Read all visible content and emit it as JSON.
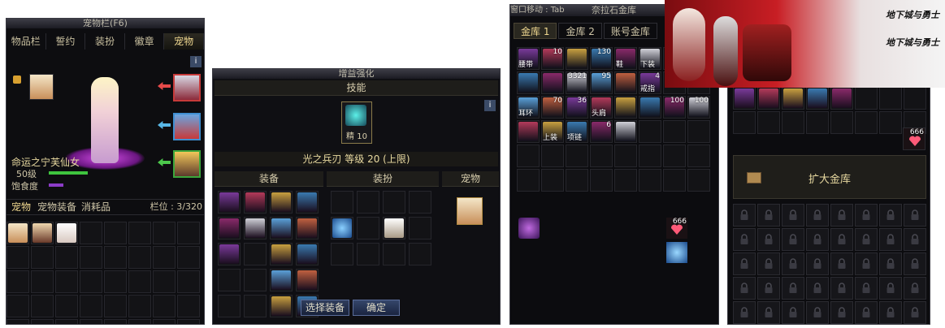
{
  "pet_panel": {
    "title": "宠物栏(F6)",
    "tabs": [
      "物品栏",
      "誓约",
      "装扮",
      "徽章",
      "宠物"
    ],
    "active_tab": "宠物",
    "info_icon": "i",
    "pet_name": "命运之宁芙仙女",
    "level": "50级",
    "satiety_label": "饱食度",
    "bottom_tabs": [
      "宠物",
      "宠物装备",
      "消耗品"
    ],
    "slots_label": "栏位 : 3/320"
  },
  "enhance_panel": {
    "title": "增益强化",
    "skill_header": "技能",
    "skill_icon_caption": "精 10",
    "skill_line": "光之兵刃 等级 20 (上限)",
    "col_equip": "装备",
    "col_avatar": "装扮",
    "col_pet": "宠物",
    "select_button": "选择装备",
    "confirm_button": "确定"
  },
  "storage_panel": {
    "title": "奈拉石金库",
    "window_move_hint": "窗口移动 : Tab",
    "tabs": [
      "金库 1",
      "金库 2",
      "账号金库"
    ],
    "items_row1": [
      {
        "label": "腰带",
        "qty": ""
      },
      {
        "label": "",
        "qty": "10"
      },
      {
        "label": "",
        "qty": ""
      },
      {
        "label": "",
        "qty": "130"
      },
      {
        "label": "鞋",
        "qty": ""
      },
      {
        "label": "下装",
        "qty": ""
      }
    ],
    "items_row2": [
      {
        "label": "",
        "qty": ""
      },
      {
        "label": "",
        "qty": ""
      },
      {
        "label": "",
        "qty": "3321"
      },
      {
        "label": "",
        "qty": "95"
      },
      {
        "label": "",
        "qty": ""
      },
      {
        "label": "戒指",
        "qty": "4"
      }
    ],
    "items_row3": [
      {
        "label": "耳环",
        "qty": ""
      },
      {
        "label": "",
        "qty": "70"
      },
      {
        "label": "",
        "qty": "36"
      },
      {
        "label": "头肩",
        "qty": ""
      },
      {
        "label": "",
        "qty": ""
      },
      {
        "label": "",
        "qty": ""
      },
      {
        "label": "",
        "qty": "100"
      },
      {
        "label": "",
        "qty": "100"
      }
    ],
    "items_row4": [
      {
        "label": "",
        "qty": ""
      },
      {
        "label": "上装",
        "qty": ""
      },
      {
        "label": "项链",
        "qty": ""
      },
      {
        "label": "",
        "qty": "6"
      },
      {
        "label": "",
        "qty": ""
      }
    ],
    "heart_qty": "666"
  },
  "expand_panel": {
    "heart_qty": "666",
    "expand_button": "扩大金库"
  },
  "banner": {
    "logo_line1": "地下城与勇士",
    "logo_line2": "地下城与勇士"
  },
  "colors": {
    "gold": "#f0d890",
    "green_bar": "#3ec43e",
    "purple_bar": "#8c3cc8",
    "confirm": "#2f3d5c"
  }
}
